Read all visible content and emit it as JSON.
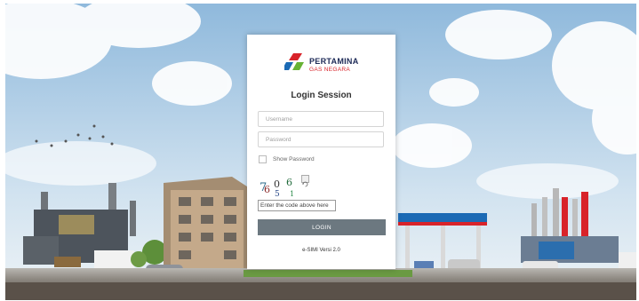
{
  "brand": {
    "name": "PERTAMINA",
    "subname": "GAS NEGARA",
    "colors": {
      "navy": "#1d2a57",
      "red": "#d8232a",
      "green": "#67b234",
      "blue": "#1b6ab5"
    }
  },
  "login": {
    "title": "Login Session",
    "username_placeholder": "Username",
    "password_placeholder": "Password",
    "show_password_label": "Show Password",
    "show_password_checked": false,
    "captcha_placeholder": "Enter the code above here",
    "login_button": "LOGIN",
    "captcha_refresh_icon": "refresh-icon"
  },
  "footer": {
    "version": "e-SIMI Versi 2.0"
  },
  "colors": {
    "sky_top": "#8fb9dc",
    "sky_bottom": "#e6eff6",
    "ground": "#5a5149",
    "button": "#6c7880"
  }
}
